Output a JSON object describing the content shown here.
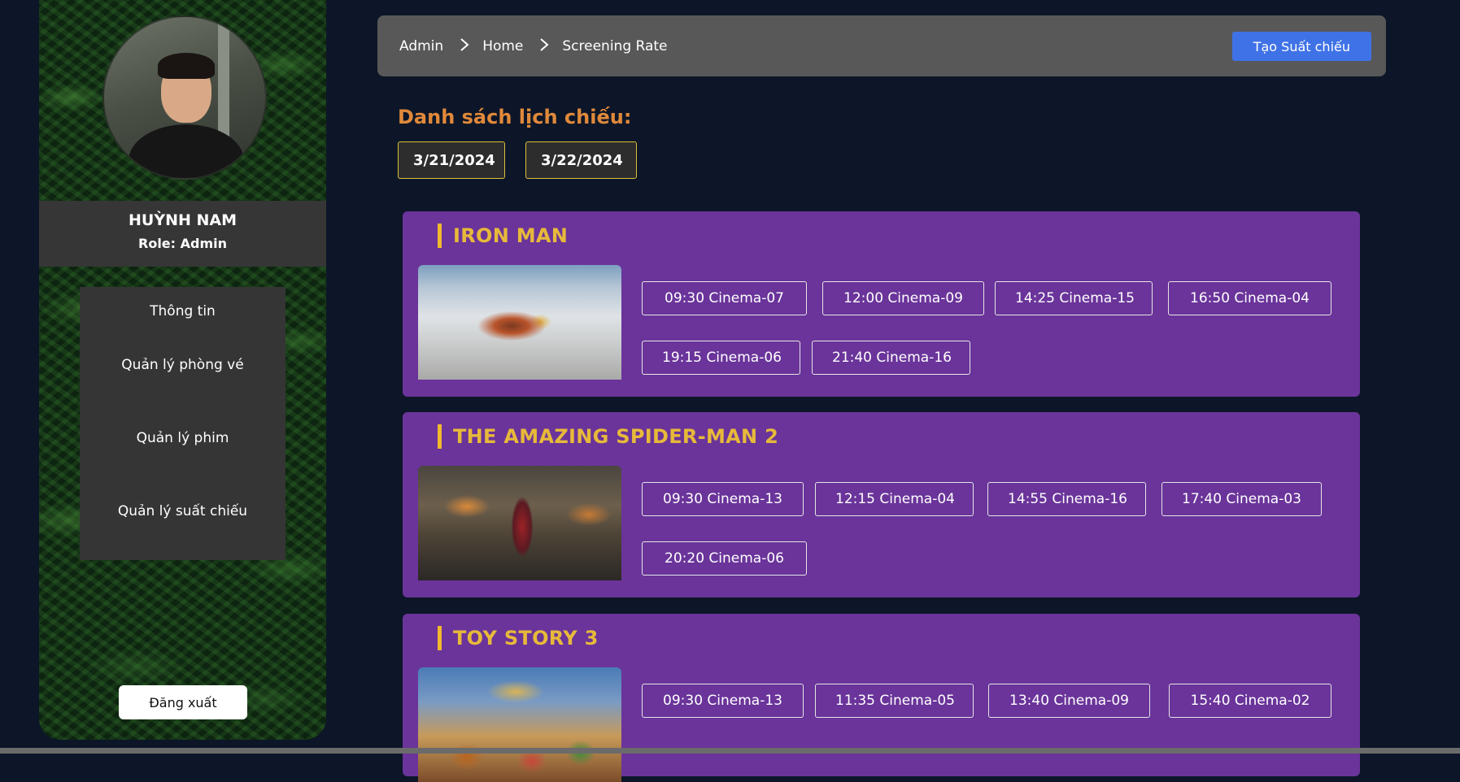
{
  "sidebar": {
    "user_name": "HUỲNH NAM",
    "role": "Role: Admin",
    "menu": [
      {
        "label": "Thông tin"
      },
      {
        "label": "Quản lý phòng vé"
      },
      {
        "label": "Quản lý phim"
      },
      {
        "label": "Quản lý suất chiếu"
      }
    ],
    "logout_label": "Đăng xuất"
  },
  "header": {
    "breadcrumb": [
      "Admin",
      "Home",
      "Screening Rate"
    ],
    "create_label": "Tạo Suất chiếu"
  },
  "main": {
    "title": "Danh sách lịch chiếu:",
    "dates": [
      "3/21/2024",
      "3/22/2024"
    ],
    "movies": [
      {
        "title": "IRON MAN",
        "showtimes": [
          "09:30 Cinema-07",
          "12:00 Cinema-09",
          "14:25 Cinema-15",
          "16:50 Cinema-04",
          "19:15 Cinema-06",
          "21:40 Cinema-16"
        ]
      },
      {
        "title": "THE AMAZING SPIDER-MAN 2",
        "showtimes": [
          "09:30 Cinema-13",
          "12:15 Cinema-04",
          "14:55 Cinema-16",
          "17:40 Cinema-03",
          "20:20 Cinema-06"
        ]
      },
      {
        "title": "TOY STORY 3",
        "showtimes": [
          "09:30 Cinema-13",
          "11:35 Cinema-05",
          "13:40 Cinema-09",
          "15:40 Cinema-02"
        ]
      }
    ]
  },
  "colors": {
    "page_bg": "#0d1628",
    "card_bg": "#6a349a",
    "title_accent": "#e0893a",
    "movie_title": "#e7b93a",
    "primary_button": "#3f72e6"
  }
}
